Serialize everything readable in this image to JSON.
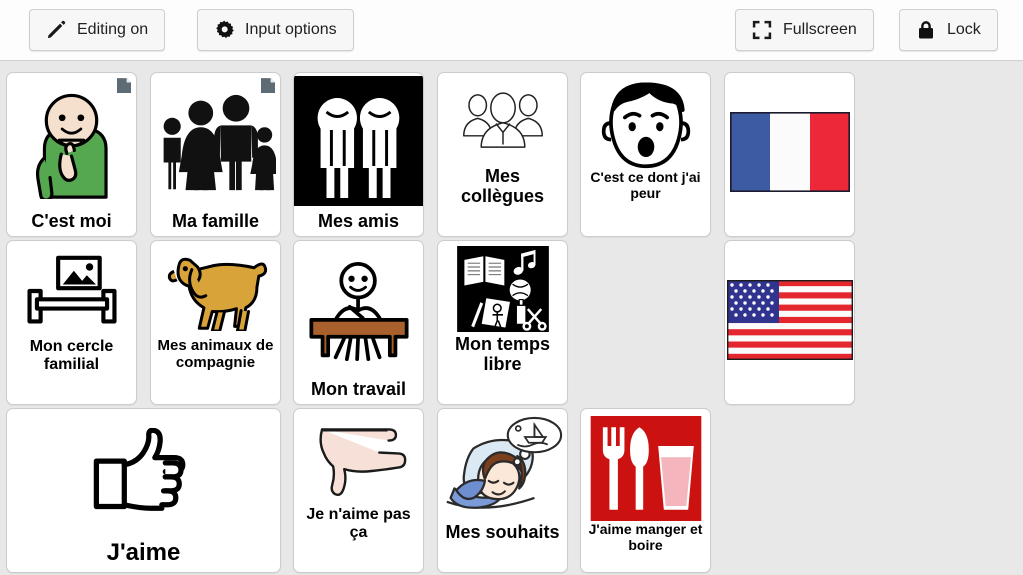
{
  "toolbar": {
    "buttons": [
      {
        "id": "editing",
        "label": "Editing on",
        "icon": "pencil-icon"
      },
      {
        "id": "input",
        "label": "Input options",
        "icon": "gear-icon"
      },
      {
        "id": "fullscreen",
        "label": "Fullscreen",
        "icon": "fullscreen-icon"
      },
      {
        "id": "lock",
        "label": "Lock",
        "icon": "lock-icon"
      }
    ]
  },
  "board": {
    "columns": 6,
    "rows": 3,
    "background_color": "#e8e8e8",
    "cell_background_color": "#ffffff",
    "cells": [
      {
        "label": "C'est moi",
        "icon": "person-pointing-self-icon",
        "badge": "page-badge-icon"
      },
      {
        "label": "Ma famille",
        "icon": "family-group-icon",
        "badge": "page-badge-icon"
      },
      {
        "label": "Mes amis",
        "icon": "two-friends-icon"
      },
      {
        "label": "Mes collègues",
        "icon": "colleagues-group-icon"
      },
      {
        "label": "C'est ce dont j'ai peur",
        "icon": "scared-face-icon"
      },
      {
        "label": "",
        "icon": "flag-france-icon"
      },
      {
        "label": "Mon cercle familial",
        "icon": "picture-shelf-icon"
      },
      {
        "label": "Mes animaux de compagnie",
        "icon": "dog-icon"
      },
      {
        "label": "Mon travail",
        "icon": "person-at-desk-icon"
      },
      {
        "label": "Mon temps libre",
        "icon": "leisure-activities-icon"
      },
      {
        "label": "",
        "icon": "empty-slot"
      },
      {
        "label": "",
        "icon": "flag-usa-icon"
      },
      {
        "label": "J'aime",
        "icon": "thumbs-up-icon"
      },
      {
        "label": "Je n'aime pas ça",
        "icon": "thumbs-down-icon"
      },
      {
        "label": "Mes souhaits",
        "icon": "person-dreaming-icon"
      },
      {
        "label": "J'aime manger et boire",
        "icon": "cutlery-drink-icon"
      }
    ]
  },
  "colors": {
    "shirt_green": "#55a84f",
    "skin": "#f5e0cd",
    "dog_tan": "#d8a43a",
    "desk_brown": "#a9602c",
    "food_red": "#cc1111",
    "flag_blue": "#3c5ba3",
    "flag_red": "#ed2939",
    "usa_blue": "#31348f",
    "usa_red": "#e4262f",
    "hair_brown": "#7b3f1d",
    "pillow_blue": "#d7e6f2",
    "pajama_blue": "#6d8fd0",
    "badge_gray": "#5d6b75"
  }
}
